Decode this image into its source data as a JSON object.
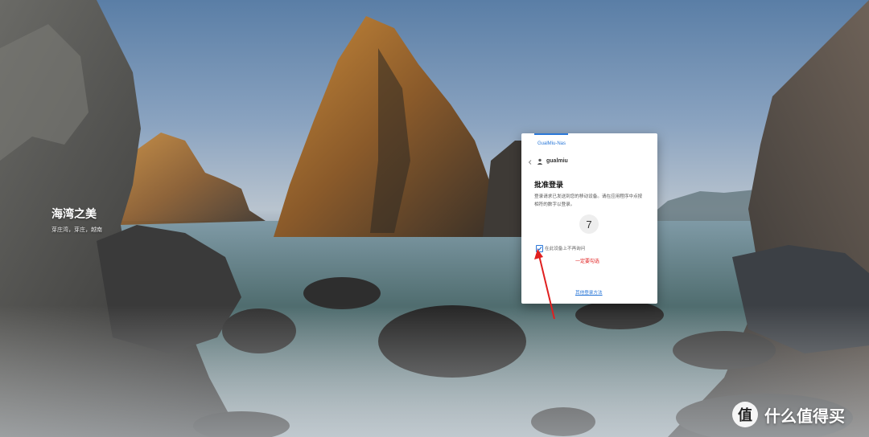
{
  "wallpaper": {
    "title": "海湾之美",
    "subtitle": "芽庄湾，芽庄，越南"
  },
  "login_panel": {
    "tab_label": "GualMiu-Nas",
    "username": "gualmiu",
    "approve_title": "批准登录",
    "approve_desc": "登录请求已发送到您的移动设备。请在应用程序中点按相符的数字以登录。",
    "code": "7",
    "remember_label": "在此设备上不再询问",
    "remember_checked": true,
    "annotation": "一定要勾选",
    "other_method": "其他登录方法"
  },
  "colors": {
    "accent": "#2b78d8",
    "annotation_red": "#e02020"
  },
  "watermark": {
    "badge": "值",
    "text": "什么值得买"
  }
}
